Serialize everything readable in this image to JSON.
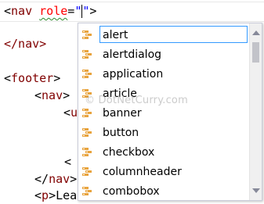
{
  "editor": {
    "lines": {
      "l1": {
        "open": "<",
        "tag": "nav",
        "space": " ",
        "attr": "role",
        "eq": "=",
        "q1": "\"",
        "q2": "\"",
        "close": ">"
      },
      "l3": {
        "text": "</nav>"
      },
      "l5": {
        "open": "<",
        "tag": "footer",
        "close": ">"
      },
      "l6": {
        "open": "<",
        "tag": "nav",
        "close": ">"
      },
      "l7": {
        "open": "<",
        "tag": "u"
      },
      "l10": {
        "open": "</",
        "tag": "nav",
        "close": ">"
      },
      "l11": {
        "open": "<",
        "tag": "p",
        "close": ">",
        "text": "Lea"
      }
    },
    "partial_closing": "<"
  },
  "completion": {
    "items": [
      {
        "label": "alert",
        "selected": true
      },
      {
        "label": "alertdialog"
      },
      {
        "label": "application"
      },
      {
        "label": "article"
      },
      {
        "label": "banner"
      },
      {
        "label": "button"
      },
      {
        "label": "checkbox"
      },
      {
        "label": "columnheader"
      },
      {
        "label": "combobox"
      }
    ],
    "item_icon": "attribute-value-icon"
  },
  "watermark": "© DotNetCurry.com",
  "colors": {
    "tag": "#800000",
    "attribute": "#ff0000",
    "value": "#0000ff",
    "selection_border": "#3399ff",
    "icon_orange": "#e8a33d"
  }
}
